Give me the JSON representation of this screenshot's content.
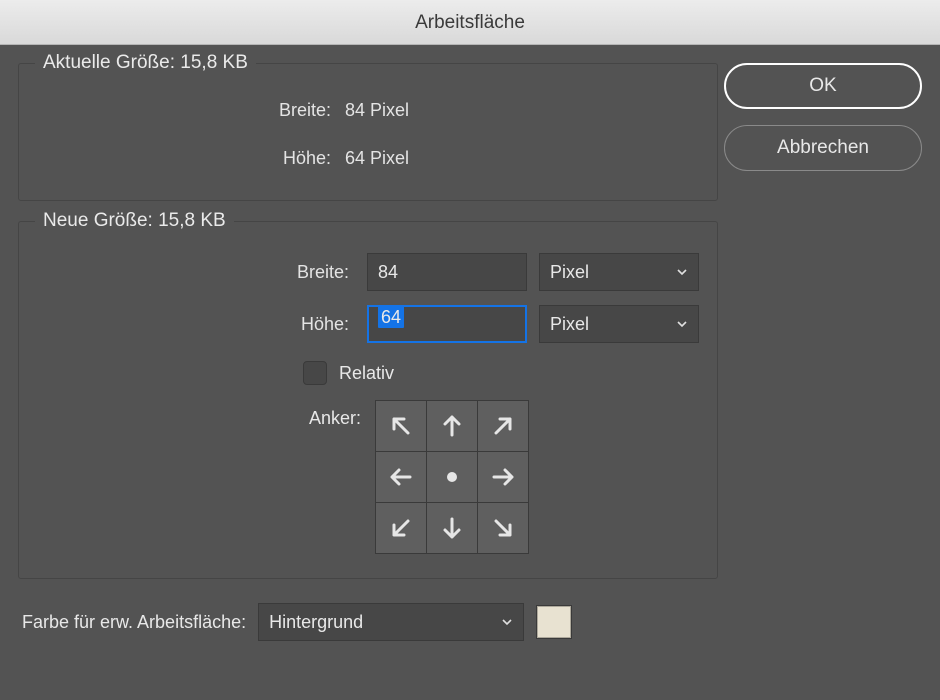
{
  "title": "Arbeitsfläche",
  "buttons": {
    "ok": "OK",
    "cancel": "Abbrechen"
  },
  "current": {
    "legend": "Aktuelle Größe: 15,8 KB",
    "width_label": "Breite:",
    "width_value": "84 Pixel",
    "height_label": "Höhe:",
    "height_value": "64 Pixel"
  },
  "new": {
    "legend": "Neue Größe: 15,8 KB",
    "width_label": "Breite:",
    "width_value": "84",
    "width_unit": "Pixel",
    "height_label": "Höhe:",
    "height_value": "64",
    "height_unit": "Pixel",
    "relative_label": "Relativ",
    "relative_checked": false,
    "anchor_label": "Anker:"
  },
  "extension": {
    "label": "Farbe für erw. Arbeitsfläche:",
    "value": "Hintergrund",
    "swatch_color": "#e8e2d1"
  }
}
